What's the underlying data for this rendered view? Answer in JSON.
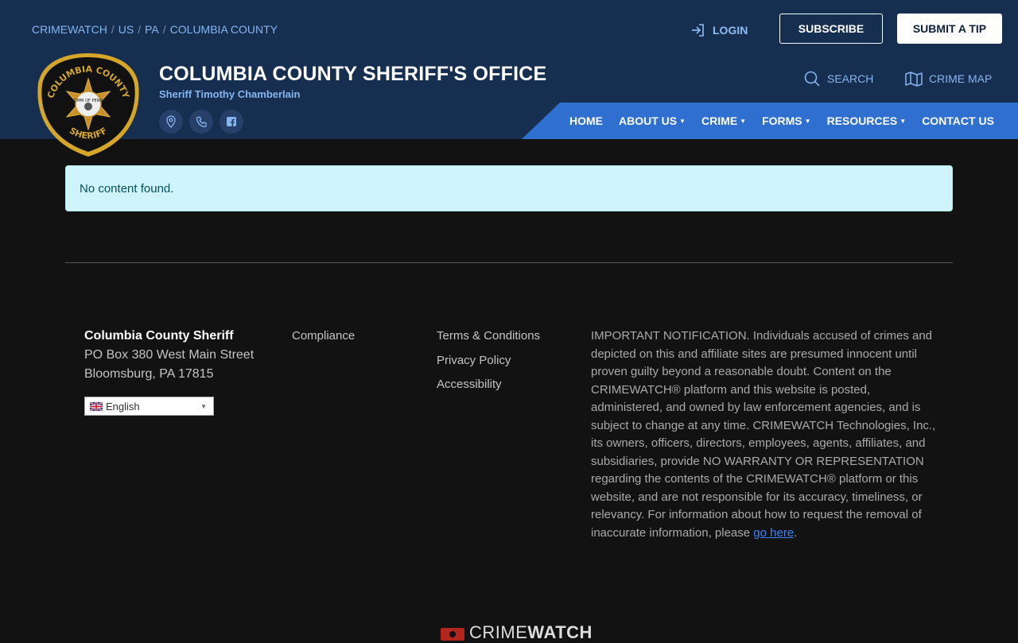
{
  "header": {
    "breadcrumb": [
      "CRIMEWATCH",
      "US",
      "PA",
      "COLUMBIA COUNTY"
    ],
    "login_label": "LOGIN",
    "subscribe_label": "SUBSCRIBE",
    "submit_tip_label": "SUBMIT A TIP",
    "title": "COLUMBIA COUNTY SHERIFF'S OFFICE",
    "subtitle": "Sheriff Timothy Chamberlain",
    "search_label": "SEARCH",
    "crime_map_label": "CRIME MAP",
    "badge": {
      "top_text": "COLUMBIA COUNTY",
      "bottom_text": "SHERIFF",
      "seal_text": "COMM OF PENNA"
    },
    "social_icons": [
      "map-pin-icon",
      "phone-icon",
      "facebook-icon"
    ]
  },
  "nav": {
    "items": [
      {
        "label": "HOME",
        "dropdown": false
      },
      {
        "label": "ABOUT US",
        "dropdown": true
      },
      {
        "label": "CRIME",
        "dropdown": true
      },
      {
        "label": "FORMS",
        "dropdown": true
      },
      {
        "label": "RESOURCES",
        "dropdown": true
      },
      {
        "label": "CONTACT US",
        "dropdown": false
      }
    ]
  },
  "main": {
    "alert_text": "No content found."
  },
  "footer": {
    "org_name": "Columbia County Sheriff",
    "address_line1": "PO Box 380 West Main Street",
    "address_line2": "Bloomsburg, PA 17815",
    "language_selected": "English",
    "compliance_label": "Compliance",
    "terms_label": "Terms & Conditions",
    "privacy_label": "Privacy Policy",
    "accessibility_label": "Accessibility",
    "notice_text": "IMPORTANT NOTIFICATION. Individuals accused of crimes and depicted on this and affiliate sites are presumed innocent until proven guilty beyond a reasonable doubt. Content on the CRIMEWATCH® platform and this website is posted, administered, and owned by law enforcement agencies, and is subject to change at any time. CRIMEWATCH Technologies, Inc., its owners, officers, directors, employees, agents, affiliates, and subsidiaries, provide NO WARRANTY OR REPRESENTATION regarding the contents of the CRIMEWATCH® platform or this website, and are not responsible for its accuracy, timeliness, or relevancy. For information about how to request the removal of inaccurate information, please",
    "notice_link": "go here",
    "notice_end": ".",
    "brand_part1": "CRIME",
    "brand_part2": "WATCH"
  },
  "colors": {
    "header_bg": "#162e50",
    "nav_bg": "#2f6fd0",
    "page_bg": "#121212",
    "alert_bg": "#cff4fc",
    "link_blue": "#86b6f0"
  }
}
